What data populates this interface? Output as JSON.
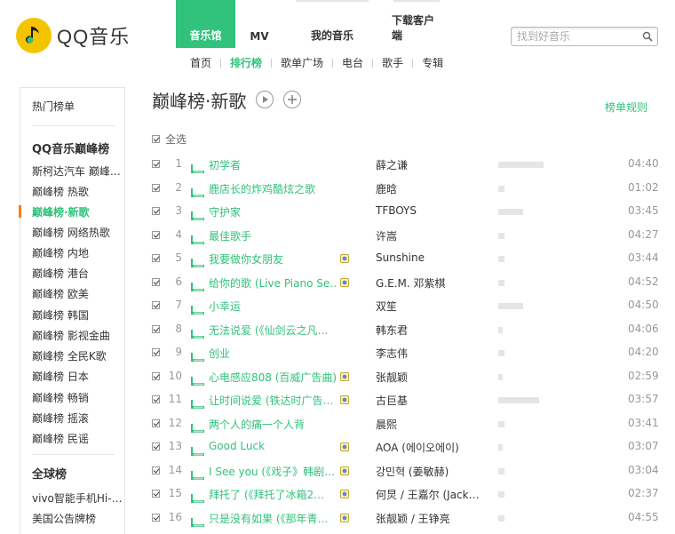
{
  "brand": {
    "name": "QQ音乐",
    "color": "#31c27c",
    "logo_color": "#f5c400"
  },
  "topnav": [
    {
      "label": "音乐馆",
      "active": true
    },
    {
      "label": "MV",
      "active": false
    },
    {
      "label": "我的音乐",
      "active": false
    },
    {
      "label": "下载客户端",
      "active": false
    }
  ],
  "search": {
    "placeholder": "找到好音乐",
    "icon": "search-icon"
  },
  "subnav": [
    {
      "label": "首页",
      "active": false
    },
    {
      "label": "排行榜",
      "active": true
    },
    {
      "label": "歌单广场",
      "active": false
    },
    {
      "label": "电台",
      "active": false
    },
    {
      "label": "歌手",
      "active": false
    },
    {
      "label": "专辑",
      "active": false
    }
  ],
  "sidebar": {
    "hot_label": "热门榜单",
    "group1_title": "QQ音乐巅峰榜",
    "group1_items": [
      {
        "label": "斯柯达汽车 巅峰榜·流行指数",
        "active": false
      },
      {
        "label": "巅峰榜 热歌",
        "active": false
      },
      {
        "label": "巅峰榜·新歌",
        "active": true
      },
      {
        "label": "巅峰榜 网络热歌",
        "active": false
      },
      {
        "label": "巅峰榜 内地",
        "active": false
      },
      {
        "label": "巅峰榜 港台",
        "active": false
      },
      {
        "label": "巅峰榜 欧美",
        "active": false
      },
      {
        "label": "巅峰榜 韩国",
        "active": false
      },
      {
        "label": "巅峰榜 影视金曲",
        "active": false
      },
      {
        "label": "巅峰榜 全民K歌",
        "active": false
      },
      {
        "label": "巅峰榜 日本",
        "active": false
      },
      {
        "label": "巅峰榜 畅销",
        "active": false
      },
      {
        "label": "巅峰榜 摇滚",
        "active": false
      },
      {
        "label": "巅峰榜 民谣",
        "active": false
      }
    ],
    "group2_title": "全球榜",
    "group2_items": [
      {
        "label": "vivo智能手机Hi-Fi榜",
        "active": false
      },
      {
        "label": "美国公告牌榜",
        "active": false
      }
    ]
  },
  "main": {
    "title": "巅峰榜·新歌",
    "play_icon": "play-circle-icon",
    "add_icon": "plus-circle-icon",
    "rules_label": "榜单规则",
    "select_all_label": "全选",
    "songs": [
      {
        "rank": "1",
        "title": "初学者",
        "gold": false,
        "singer": "薛之谦",
        "popularity": 0.55,
        "duration": "04:40"
      },
      {
        "rank": "2",
        "title": "鹿店长的炸鸡酷炫之歌",
        "gold": false,
        "singer": "鹿晗",
        "popularity": 0.08,
        "duration": "01:02"
      },
      {
        "rank": "3",
        "title": "守护家",
        "gold": false,
        "singer": "TFBOYS",
        "popularity": 0.3,
        "duration": "03:45"
      },
      {
        "rank": "4",
        "title": "最佳歌手",
        "gold": false,
        "singer": "许嵩",
        "popularity": 0.08,
        "duration": "04:27"
      },
      {
        "rank": "5",
        "title": "我要做你女朋友",
        "gold": true,
        "singer": "Sunshine",
        "popularity": 0.08,
        "duration": "03:44"
      },
      {
        "rank": "6",
        "title": "给你的歌 (Live Piano Se…",
        "gold": true,
        "singer": "G.E.M. 邓紫棋",
        "popularity": 0.08,
        "duration": "04:52"
      },
      {
        "rank": "7",
        "title": "小幸运",
        "gold": false,
        "singer": "双笙",
        "popularity": 0.3,
        "duration": "04:50"
      },
      {
        "rank": "8",
        "title": "无法说爱 (《仙剑云之凡…",
        "gold": false,
        "singer": "韩东君",
        "popularity": 0.05,
        "duration": "04:06"
      },
      {
        "rank": "9",
        "title": "创业",
        "gold": false,
        "singer": "李志伟",
        "popularity": 0.08,
        "duration": "04:20"
      },
      {
        "rank": "10",
        "title": "心电感应808 (百威广告曲)",
        "gold": true,
        "singer": "张靓颖",
        "popularity": 0.05,
        "duration": "02:59"
      },
      {
        "rank": "11",
        "title": "让时间说爱 (铁达时广告…",
        "gold": true,
        "singer": "古巨基",
        "popularity": 0.5,
        "duration": "03:57"
      },
      {
        "rank": "12",
        "title": "两个人的痛一个人背",
        "gold": false,
        "singer": "晨熙",
        "popularity": 0.08,
        "duration": "03:41"
      },
      {
        "rank": "13",
        "title": "Good Luck",
        "gold": true,
        "singer": "AOA (에이오에이)",
        "popularity": 0.05,
        "duration": "03:07"
      },
      {
        "rank": "14",
        "title": "I See you (《戏子》韩剧…",
        "gold": true,
        "singer": "강민혁 (姜敏赫)",
        "popularity": 0.08,
        "duration": "03:04"
      },
      {
        "rank": "15",
        "title": "拜托了 (《拜托了冰箱2…",
        "gold": true,
        "singer": "何炅 / 王嘉尔 (Jack…",
        "popularity": 0.08,
        "duration": "02:37"
      },
      {
        "rank": "16",
        "title": "只是没有如果 (《那年青…",
        "gold": true,
        "singer": "张靓颖 / 王铮亮",
        "popularity": 0.08,
        "duration": "04:55"
      }
    ]
  }
}
